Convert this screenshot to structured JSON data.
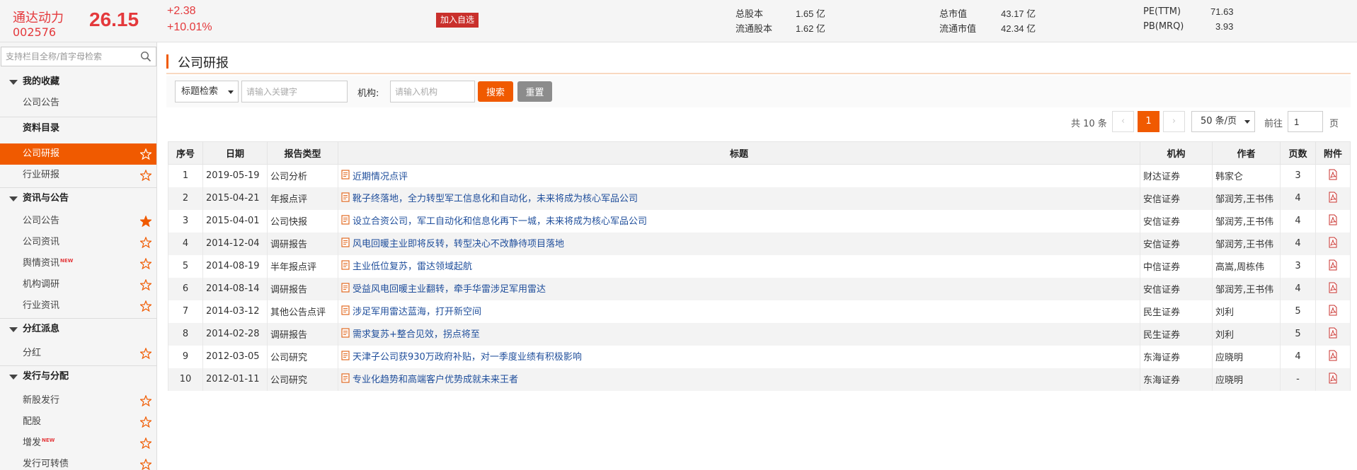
{
  "stock": {
    "name": "通达动力",
    "code": "002576",
    "price": "26.15",
    "change": "+2.38",
    "change_pct": "+10.01%",
    "watch_label": "加入自选"
  },
  "stats": [
    {
      "label": "总股本",
      "value": "1.65 亿"
    },
    {
      "label": "流通股本",
      "value": "1.62 亿"
    },
    {
      "label": "总市值",
      "value": "43.17 亿"
    },
    {
      "label": "流通市值",
      "value": "42.34 亿"
    },
    {
      "label": "PE(TTM)",
      "value": "71.63"
    },
    {
      "label": "PB(MRQ)",
      "value": "3.93"
    }
  ],
  "sidebar": {
    "search_placeholder": "支持栏目全称/首字母检索",
    "groups": [
      {
        "label": "我的收藏"
      },
      {
        "label": "资料目录"
      },
      {
        "label": "资讯与公告"
      },
      {
        "label": "分红派息"
      },
      {
        "label": "发行与分配"
      }
    ],
    "items": [
      {
        "label": "公司公告",
        "star": "none"
      },
      {
        "label": "公司研报",
        "star": "white-outline",
        "active": true
      },
      {
        "label": "行业研报",
        "star": "outline"
      },
      {
        "label": "公司公告",
        "star": "filled"
      },
      {
        "label": "公司资讯",
        "star": "outline"
      },
      {
        "label": "舆情资讯",
        "new": "NEW",
        "star": "outline"
      },
      {
        "label": "机构调研",
        "star": "outline"
      },
      {
        "label": "行业资讯",
        "star": "outline"
      },
      {
        "label": "分红",
        "star": "outline"
      },
      {
        "label": "新股发行",
        "star": "outline"
      },
      {
        "label": "配股",
        "star": "outline"
      },
      {
        "label": "增发",
        "new": "NEW",
        "star": "outline"
      },
      {
        "label": "发行可转债",
        "star": "outline"
      }
    ]
  },
  "main": {
    "title": "公司研报",
    "filter": {
      "search_type": "标题检索",
      "keyword_placeholder": "请输入关键字",
      "org_label": "机构:",
      "org_placeholder": "请输入机构",
      "search_btn": "搜索",
      "reset_btn": "重置"
    },
    "pager": {
      "total": "共 10 条",
      "prev": "‹",
      "current": "1",
      "next": "›",
      "page_size": "50 条/页",
      "goto_label": "前往",
      "goto_value": "1",
      "page_suffix": "页"
    },
    "columns": [
      "序号",
      "日期",
      "报告类型",
      "标题",
      "机构",
      "作者",
      "页数",
      "附件"
    ],
    "rows": [
      {
        "no": "1",
        "date": "2019-05-19",
        "type": "公司分析",
        "title": "近期情况点评",
        "org": "财达证券",
        "author": "韩家仑",
        "pages": "3"
      },
      {
        "no": "2",
        "date": "2015-04-21",
        "type": "年报点评",
        "title": "靴子终落地，全力转型军工信息化和自动化，未来将成为核心军品公司",
        "org": "安信证券",
        "author": "邹润芳,王书伟",
        "pages": "4"
      },
      {
        "no": "3",
        "date": "2015-04-01",
        "type": "公司快报",
        "title": "设立合资公司，军工自动化和信息化再下一城，未来将成为核心军品公司",
        "org": "安信证券",
        "author": "邹润芳,王书伟",
        "pages": "4"
      },
      {
        "no": "4",
        "date": "2014-12-04",
        "type": "调研报告",
        "title": "风电回暖主业即将反转，转型决心不改静待项目落地",
        "org": "安信证券",
        "author": "邹润芳,王书伟",
        "pages": "4"
      },
      {
        "no": "5",
        "date": "2014-08-19",
        "type": "半年报点评",
        "title": "主业低位复苏，雷达领域起航",
        "org": "中信证券",
        "author": "高嵩,周栋伟",
        "pages": "3"
      },
      {
        "no": "6",
        "date": "2014-08-14",
        "type": "调研报告",
        "title": "受益风电回暖主业翻转，牵手华雷涉足军用雷达",
        "org": "安信证券",
        "author": "邹润芳,王书伟",
        "pages": "4"
      },
      {
        "no": "7",
        "date": "2014-03-12",
        "type": "其他公告点评",
        "title": "涉足军用雷达蓝海，打开新空间",
        "org": "民生证券",
        "author": "刘利",
        "pages": "5"
      },
      {
        "no": "8",
        "date": "2014-02-28",
        "type": "调研报告",
        "title": "需求复苏+整合见效，拐点将至",
        "org": "民生证券",
        "author": "刘利",
        "pages": "5"
      },
      {
        "no": "9",
        "date": "2012-03-05",
        "type": "公司研究",
        "title": "天津子公司获930万政府补贴，对一季度业绩有积极影响",
        "org": "东海证券",
        "author": "应晓明",
        "pages": "4"
      },
      {
        "no": "10",
        "date": "2012-01-11",
        "type": "公司研究",
        "title": "专业化趋势和高端客户优势成就未来王者",
        "org": "东海证券",
        "author": "应晓明",
        "pages": "-"
      }
    ]
  },
  "colors": {
    "accent": "#f05a00",
    "up": "#e4393c",
    "link": "#1f4e9b",
    "watch_btn": "#c9302c"
  }
}
